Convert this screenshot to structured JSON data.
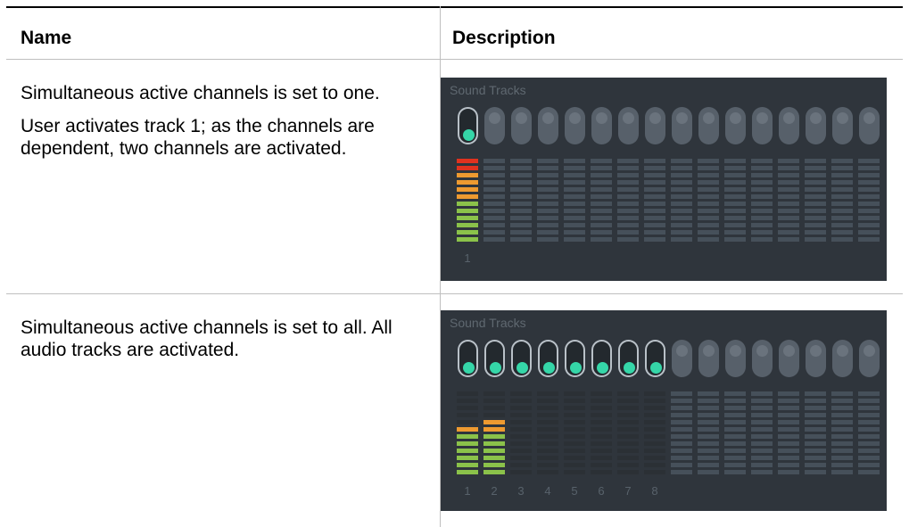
{
  "table": {
    "header": {
      "name": "Name",
      "description": "Description"
    },
    "rows": [
      {
        "paragraphs": [
          "Simultaneous active channels is set to one.",
          "User activates track 1; as the channels are dependent, two channels are activated."
        ],
        "panel": {
          "title": "Sound Tracks",
          "track_count": 16,
          "active_buttons": [
            1
          ],
          "meters_lit": [
            1
          ],
          "meter_levels": [
            1.0
          ],
          "track_labels": [
            "1"
          ]
        }
      },
      {
        "paragraphs": [
          "Simultaneous active channels is set to all. All audio tracks are activated."
        ],
        "panel": {
          "title": "Sound Tracks",
          "track_count": 16,
          "active_buttons": [
            1,
            2,
            3,
            4,
            5,
            6,
            7,
            8
          ],
          "meters_lit": [
            1,
            2,
            3,
            4,
            5,
            6,
            7,
            8
          ],
          "meter_levels": [
            0.58,
            0.67,
            0,
            0,
            0,
            0,
            0,
            0
          ],
          "track_labels": [
            "1",
            "2",
            "3",
            "4",
            "5",
            "6",
            "7",
            "8"
          ]
        }
      }
    ]
  },
  "colors": {
    "panel_bg": "#2f353c",
    "active_knob": "#35d6a8",
    "meter_green": "#8bc24a",
    "meter_orange": "#ee9a30",
    "meter_red": "#e0321f"
  }
}
